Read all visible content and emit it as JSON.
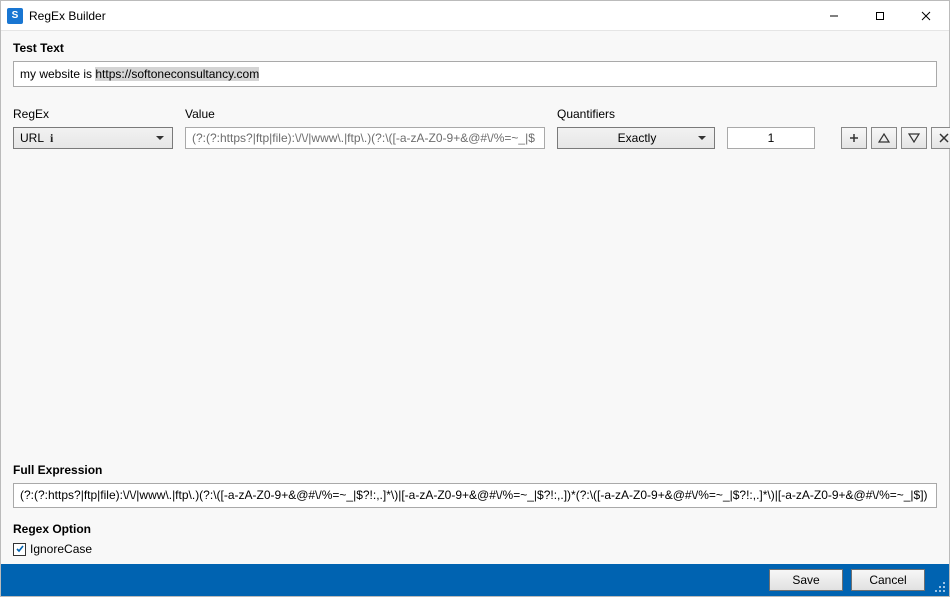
{
  "window": {
    "title": "RegEx Builder"
  },
  "test": {
    "heading": "Test Text",
    "prefix": "my website is ",
    "match": "https://softoneconsultancy.com"
  },
  "rule": {
    "regex_label": "RegEx",
    "value_label": "Value",
    "quant_label": "Quantifiers",
    "regex_selected": "URL",
    "value_text": "(?:(?:https?|ftp|file):\\/\\/|www\\.|ftp\\.)(?:\\([-a-zA-Z0-9+&@#\\/%=~_|$",
    "quant_selected": "Exactly",
    "count": "1"
  },
  "full_expr": {
    "heading": "Full Expression",
    "text": "(?:(?:https?|ftp|file):\\/\\/|www\\.|ftp\\.)(?:\\([-a-zA-Z0-9+&@#\\/%=~_|$?!:,.]*\\)|[-a-zA-Z0-9+&@#\\/%=~_|$?!:,.])*(?:\\([-a-zA-Z0-9+&@#\\/%=~_|$?!:,.]*\\)|[-a-zA-Z0-9+&@#\\/%=~_|$])"
  },
  "options": {
    "heading": "Regex Option",
    "ignorecase_label": "IgnoreCase",
    "ignorecase_checked": true
  },
  "footer": {
    "save": "Save",
    "cancel": "Cancel"
  }
}
